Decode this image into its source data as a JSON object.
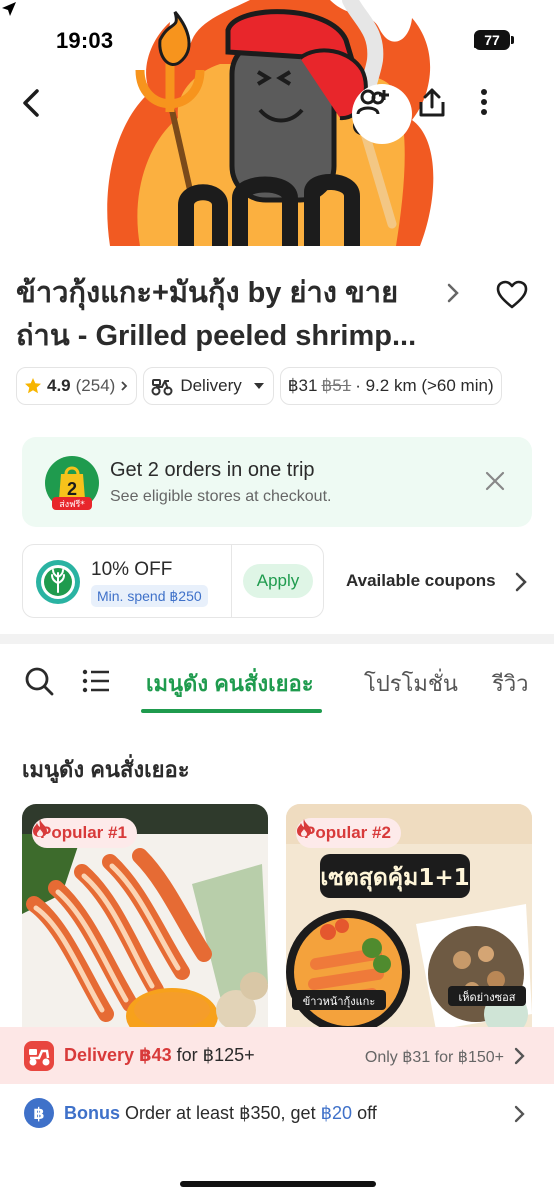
{
  "status_bar": {
    "time": "19:03",
    "battery": "77"
  },
  "hero": {
    "image_description": "store-mascot-banner"
  },
  "icons": {
    "back": "back-arrow-icon",
    "add_friend": "add-person-icon",
    "share": "share-icon",
    "more": "more-vertical-icon",
    "favorite": "heart-icon",
    "search": "search-icon",
    "menu_list": "list-icon"
  },
  "store": {
    "name_line1": "ข้าวกุ้งแกะ+มันกุ้ง by ย่าง ขาย",
    "name_line2": "ถ่าน - Grilled peeled shrimp...",
    "rating": "4.9",
    "rating_count": "(254)",
    "delivery_mode": "Delivery",
    "fee": "฿31",
    "fee_original": "฿51",
    "distance": "· 9.2 km (>60 min)"
  },
  "promo": {
    "badge_number": "2",
    "badge_text": "ส่งฟรี*",
    "title": "Get 2 orders in one trip",
    "subtitle": "See eligible stores at checkout."
  },
  "coupon": {
    "discount": "10% OFF",
    "min_spend": "Min. spend ฿250",
    "apply_label": "Apply",
    "available_label": "Available coupons"
  },
  "tabs": [
    {
      "label": "เมนูดัง คนสั่งเยอะ",
      "active": true
    },
    {
      "label": "โปรโมชั่น",
      "active": false
    },
    {
      "label": "รีวิว",
      "active": false
    }
  ],
  "section_title": "เมนูดัง คนสั่งเยอะ",
  "products": [
    {
      "badge": "Popular #1",
      "image_text": []
    },
    {
      "badge": "Popular #2",
      "image_text": [
        "เซตสุดคุ้ม1+1",
        "ข้าวหน้ากุ้งแกะ",
        "เห็ดย่างซอส"
      ]
    }
  ],
  "delivery_bar": {
    "label": "Delivery",
    "price": "฿43",
    "threshold": "for ฿125+",
    "right_text": "Only ฿31 for ฿150+"
  },
  "bonus_bar": {
    "label": "Bonus",
    "text_before": "Order at least ฿350, get",
    "amount": "฿20",
    "text_after": "off"
  },
  "colors": {
    "accent_green": "#1f9b4e",
    "promo_bg": "#eefaf3",
    "delivery_bar_bg": "#fde7e6",
    "badge_red": "#d83a3a",
    "bonus_blue": "#3f71c9"
  }
}
